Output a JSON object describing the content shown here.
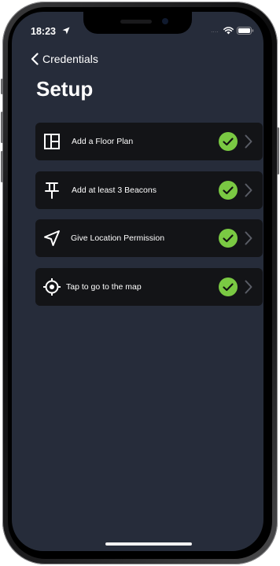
{
  "status_bar": {
    "time": "18:23",
    "carrier": "....",
    "icons": [
      "location-arrow-icon",
      "wifi-icon",
      "battery-icon"
    ]
  },
  "navigation": {
    "back_label": "Credentials"
  },
  "page": {
    "title": "Setup"
  },
  "steps": [
    {
      "label": "Add a Floor Plan",
      "icon": "floor-plan-icon",
      "completed": true
    },
    {
      "label": "Add at least 3 Beacons",
      "icon": "pin-icon",
      "completed": true
    },
    {
      "label": "Give Location Permission",
      "icon": "location-arrow-icon",
      "completed": true
    },
    {
      "label": "Tap to go to the map",
      "icon": "target-icon",
      "completed": true
    }
  ],
  "colors": {
    "background": "#262c3a",
    "row_background": "#131417",
    "check": "#7ac943",
    "chevron": "#5a5d66"
  }
}
